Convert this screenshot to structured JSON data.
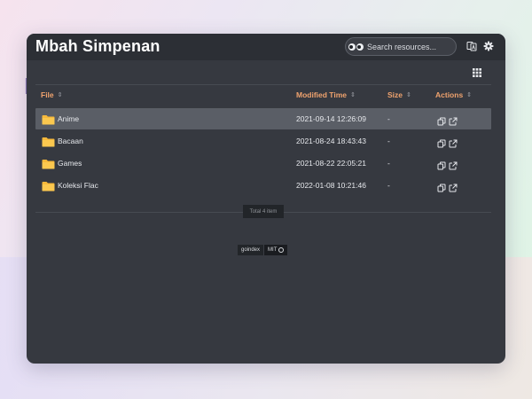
{
  "site": {
    "title": "Mbah Simpenan"
  },
  "search": {
    "placeholder": "Search resources..."
  },
  "icons": {
    "search": "eyes-icon",
    "language": "translate-icon",
    "settings": "gear-icon",
    "view": "grid-view-icon",
    "folder": "folder-icon",
    "copy": "copy-icon",
    "open": "external-link-icon"
  },
  "colors": {
    "accent": "#f0a36e",
    "folder": "#f7b93b",
    "background": "#363940",
    "selected_row": "#5a5e66"
  },
  "table": {
    "headers": {
      "file": "File",
      "modified": "Modified Time",
      "size": "Size",
      "actions": "Actions"
    },
    "rows": [
      {
        "name": "Anime",
        "modified": "2021-09-14 12:26:09",
        "size": "-",
        "selected": true
      },
      {
        "name": "Bacaan",
        "modified": "2021-08-24 18:43:43",
        "size": "-",
        "selected": false
      },
      {
        "name": "Games",
        "modified": "2021-08-22 22:05:21",
        "size": "-",
        "selected": false
      },
      {
        "name": "Koleksi Flac",
        "modified": "2022-01-08 10:21:46",
        "size": "-",
        "selected": false
      }
    ]
  },
  "summary": {
    "total": "Total 4 item"
  },
  "footer": {
    "left": "goindex",
    "right": "MIT"
  }
}
